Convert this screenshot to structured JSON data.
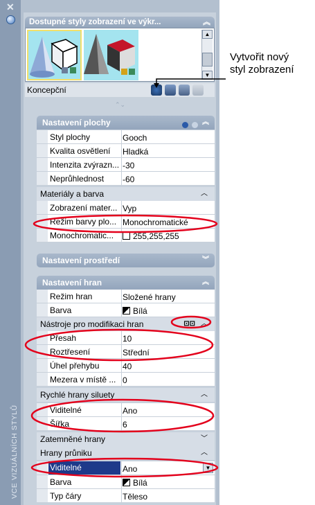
{
  "palette_title": "VCE VIZUÁLNÍCH STYLŮ",
  "gallery": {
    "title": "Dostupné styly zobrazení ve výkr...",
    "current_style": "Koncepční"
  },
  "callout": {
    "line1": "Vytvořit nový",
    "line2": "styl zobrazení"
  },
  "sections": {
    "face": {
      "title": "Nastavení plochy",
      "rows": [
        {
          "label": "Styl plochy",
          "value": "Gooch"
        },
        {
          "label": "Kvalita osvětlení",
          "value": "Hladká"
        },
        {
          "label": "Intenzita zvýrazn...",
          "value": "-30"
        },
        {
          "label": "Neprůhlednost",
          "value": "-60"
        }
      ],
      "materials": {
        "title": "Materiály a barva",
        "rows": [
          {
            "label": "Zobrazení mater...",
            "value": "Vyp"
          },
          {
            "label": "Režim barvy plo...",
            "value": "Monochromatické"
          },
          {
            "label": "Monochromatic...",
            "value": "255,255,255"
          }
        ]
      }
    },
    "environment": {
      "title": "Nastavení prostředí"
    },
    "edges": {
      "title": "Nastavení hran",
      "rows": [
        {
          "label": "Režim hran",
          "value": "Složené hrany"
        },
        {
          "label": "Barva",
          "value": "Bílá"
        }
      ],
      "modifiers": {
        "title": "Nástroje pro modifikaci hran",
        "rows": [
          {
            "label": "Přesah",
            "value": "10"
          },
          {
            "label": "Roztřesení",
            "value": "Střední"
          },
          {
            "label": "Úhel přehybu",
            "value": "40"
          },
          {
            "label": "Mezera v místě ...",
            "value": "0"
          }
        ]
      },
      "silhouette": {
        "title": "Rychlé hrany siluety",
        "rows": [
          {
            "label": "Viditelné",
            "value": "Ano"
          },
          {
            "label": "Šířka",
            "value": "6"
          }
        ]
      },
      "obscured": {
        "title": "Zatemněné hrany"
      },
      "intersection": {
        "title": "Hrany průniku",
        "rows": [
          {
            "label": "Viditelné",
            "value": "Ano"
          },
          {
            "label": "Barva",
            "value": "Bílá"
          },
          {
            "label": "Typ čáry",
            "value": "Těleso"
          }
        ]
      }
    }
  },
  "colors": {
    "accent": "#e3001b",
    "selection": "#1e3a8a",
    "header": "#9aaabf"
  }
}
